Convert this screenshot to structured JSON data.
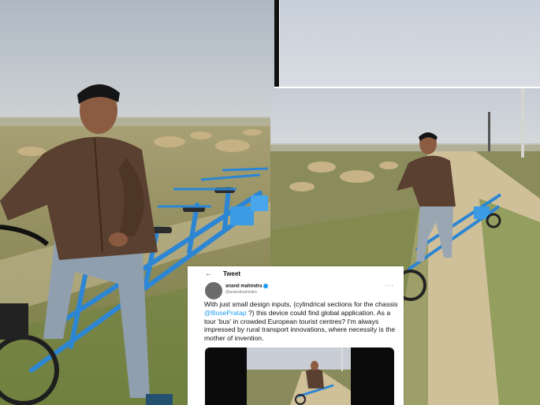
{
  "tweet": {
    "header_title": "Tweet",
    "back_icon": "arrow-left-icon",
    "author_name": "anand mahindra",
    "author_handle": "@anandmahindra",
    "more_icon": "more-icon",
    "text_before": "With just small design inputs, (cylindrical sections for the chassis ",
    "mention": "@BosePratap",
    "text_after": " ?) this device could find global application. As a tour 'bus' in crowded European tourist centres? I'm always impressed by rural transport innovations, where necessity is the mother of invention.",
    "media": "video-thumbnail"
  },
  "colors": {
    "bike_frame": "#2c86d4",
    "jacket": "#5a4030",
    "link": "#1d9bf0"
  }
}
